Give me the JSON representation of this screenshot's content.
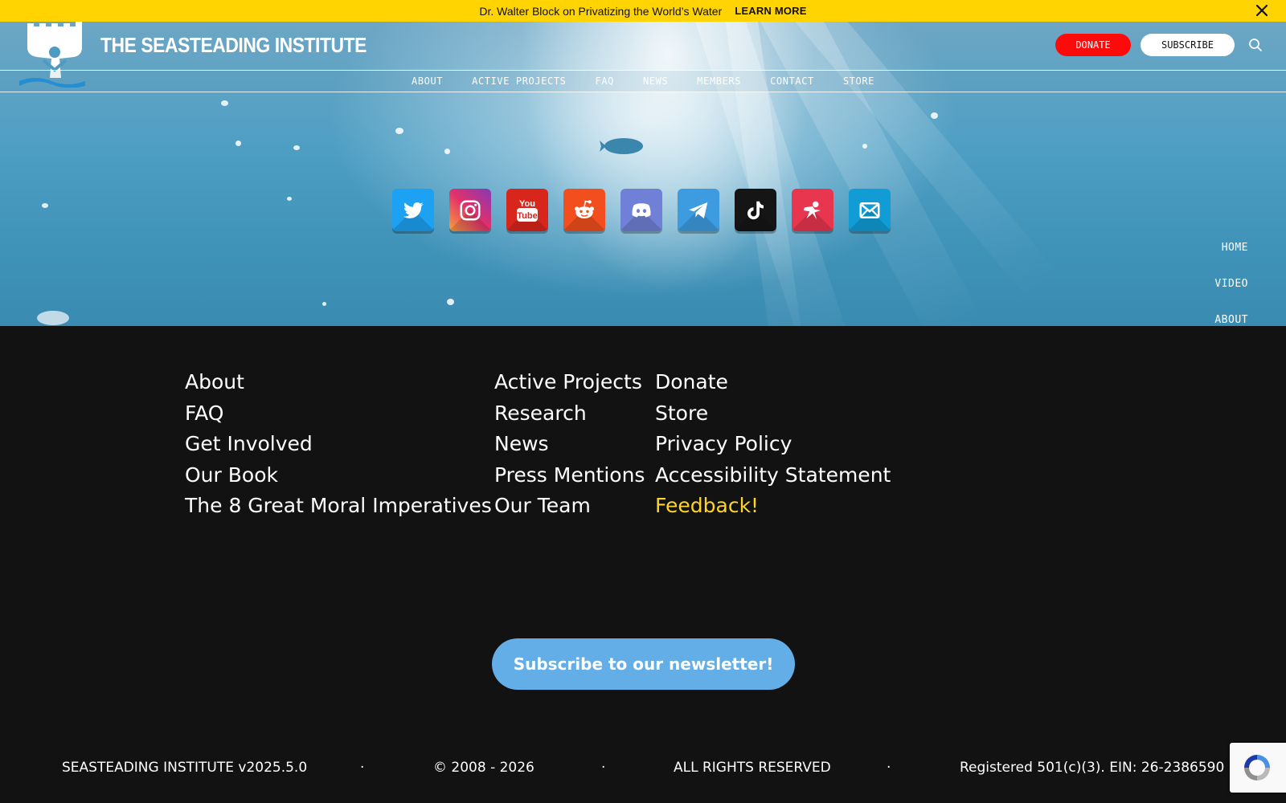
{
  "announcement": {
    "text": "Dr. Walter Block on Privatizing the World’s Water",
    "link_label": "LEARN MORE",
    "close_icon": "close-icon"
  },
  "header": {
    "brand": "THE SEASTEADING INSTITUTE",
    "donate_label": "DONATE",
    "subscribe_label": "SUBSCRIBE",
    "search_icon": "search-icon",
    "logo": "seasteading-logo"
  },
  "nav": {
    "items": [
      {
        "label": "ABOUT"
      },
      {
        "label": "ACTIVE PROJECTS"
      },
      {
        "label": "FAQ"
      },
      {
        "label": "NEWS"
      },
      {
        "label": "MEMBERS"
      },
      {
        "label": "CONTACT"
      },
      {
        "label": "STORE"
      }
    ]
  },
  "social": [
    {
      "icon": "twitter-icon",
      "color": "#1da1f2"
    },
    {
      "icon": "instagram-icon",
      "color": "#d6249f"
    },
    {
      "icon": "youtube-icon",
      "color": "#e62117"
    },
    {
      "icon": "reddit-icon",
      "color": "#ff4500"
    },
    {
      "icon": "discord-icon",
      "color": "#7289da"
    },
    {
      "icon": "telegram-icon",
      "color": "#3b9ee0"
    },
    {
      "icon": "tiktok-icon",
      "color": "#111111"
    },
    {
      "icon": "patreon-icon",
      "color": "#ea3550"
    },
    {
      "icon": "email-icon",
      "color": "#119cd6"
    }
  ],
  "side_nav": {
    "items": [
      {
        "label": "HOME"
      },
      {
        "label": "VIDEO"
      },
      {
        "label": "ABOUT"
      }
    ]
  },
  "footer": {
    "columns": [
      [
        "About",
        "FAQ",
        "Get Involved",
        "Our Book",
        "The 8 Great Moral Imperatives"
      ],
      [
        "Active Projects",
        "Research",
        "News",
        "Press Mentions",
        "Our Team"
      ],
      [
        "Donate",
        "Store",
        "Privacy Policy",
        "Accessibility Statement",
        "Feedback!"
      ]
    ],
    "newsletter_label": "Subscribe to our newsletter!",
    "bottom": {
      "version": "SEASTEADING INSTITUTE v2025.5.0",
      "copyright": "© 2008 - 2026",
      "rights": "ALL RIGHTS RESERVED",
      "registration": "Registered 501(c)(3). EIN: 26-2386590",
      "separator": "·"
    }
  },
  "colors": {
    "announcement_bg": "#ffd400",
    "donate": "#ff0a0a",
    "newsletter": "#64aee8",
    "highlight_link": "#ffd42a",
    "footer_bg": "#121212"
  }
}
